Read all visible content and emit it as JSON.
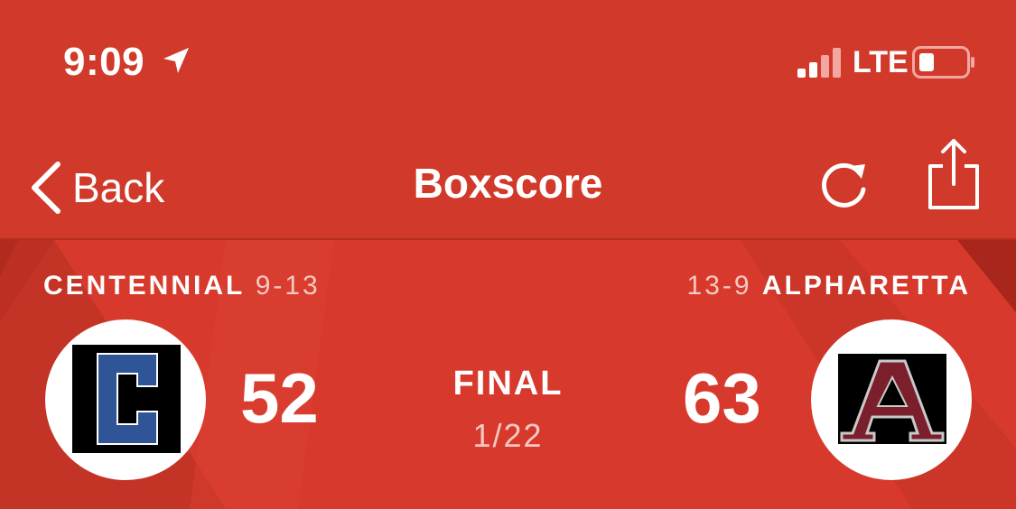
{
  "status_bar": {
    "time": "9:09",
    "carrier": "LTE",
    "signal_icon": "signal-bars-icon",
    "battery_icon": "battery-low-icon",
    "location_icon": "location-arrow-icon"
  },
  "nav": {
    "back_label": "Back",
    "title": "Boxscore",
    "refresh_icon": "refresh-icon",
    "share_icon": "share-icon"
  },
  "game": {
    "away": {
      "name": "CENTENNIAL",
      "record": "9-13",
      "score": "52",
      "logo_letter": "C",
      "logo_color": "#2f5597"
    },
    "home": {
      "name": "ALPHARETTA",
      "record": "13-9",
      "score": "63",
      "logo_letter": "A",
      "logo_color": "#7a1f2b"
    },
    "status": "FINAL",
    "date": "1/22"
  },
  "colors": {
    "background": "#d13a2b",
    "text": "#ffffff",
    "muted_text": "#f6c8c0"
  }
}
